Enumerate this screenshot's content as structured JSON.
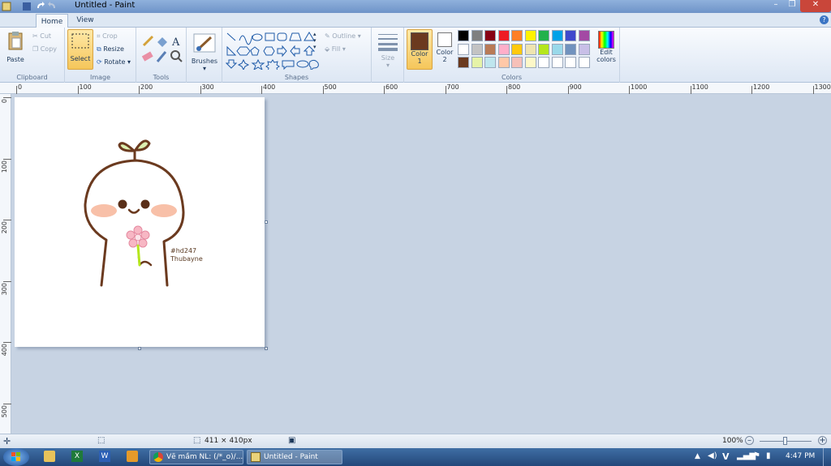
{
  "window": {
    "title": "Untitled - Paint",
    "minimize": "–",
    "restore": "❐",
    "close": "✕"
  },
  "tabs": {
    "file_menu": "▤ ▾",
    "home": "Home",
    "view": "View"
  },
  "ribbon": {
    "clipboard": {
      "label": "Clipboard",
      "paste": "Paste",
      "cut": "Cut",
      "copy": "Copy"
    },
    "image": {
      "label": "Image",
      "select": "Select",
      "crop": "Crop",
      "resize": "Resize",
      "rotate": "Rotate"
    },
    "tools": {
      "label": "Tools"
    },
    "brushes": {
      "label": "Brushes"
    },
    "shapes": {
      "label": "Shapes",
      "outline": "Outline",
      "fill": "Fill"
    },
    "size": {
      "label": "Size"
    },
    "colors": {
      "label": "Colors",
      "color1": "Color",
      "color1_num": "1",
      "color2": "Color",
      "color2_num": "2",
      "edit": "Edit",
      "edit2": "colors",
      "color1_value": "#6b3a1f",
      "color2_value": "#ffffff",
      "palette_row1": [
        "#000000",
        "#7f7f7f",
        "#880015",
        "#ed1c24",
        "#ff7f27",
        "#fff200",
        "#22b14c",
        "#00a2e8",
        "#3f48cc",
        "#a349a4"
      ],
      "palette_row2": [
        "#ffffff",
        "#c3c3c3",
        "#b97a57",
        "#ffaec9",
        "#ffc90e",
        "#efe4b0",
        "#b5e61d",
        "#99d9ea",
        "#7092be",
        "#c8bfe7"
      ],
      "palette_row3": [
        "#6b3a1f",
        "#e6f3a8",
        "#bfe6ee",
        "#ffc8a8",
        "#f6c0b8",
        "#fdf8c8",
        "#ffffff",
        "#ffffff",
        "#ffffff",
        "#ffffff"
      ]
    }
  },
  "ruler": {
    "top": [
      "0",
      "100",
      "200",
      "300",
      "400",
      "500",
      "600",
      "700",
      "800",
      "900",
      "1000",
      "1100",
      "1200",
      "1300"
    ],
    "left": [
      "0",
      "100",
      "200",
      "300",
      "400",
      "500"
    ]
  },
  "drawing": {
    "signature_line1": "#hd247",
    "signature_line2": "Thubayne"
  },
  "status": {
    "size": "411 × 410px",
    "zoom": "100%"
  },
  "taskbar": {
    "chrome_task": "Vẽ mầm NL: (/*_o)/...",
    "paint_task": "Untitled - Paint",
    "clock": "4:47 PM"
  }
}
